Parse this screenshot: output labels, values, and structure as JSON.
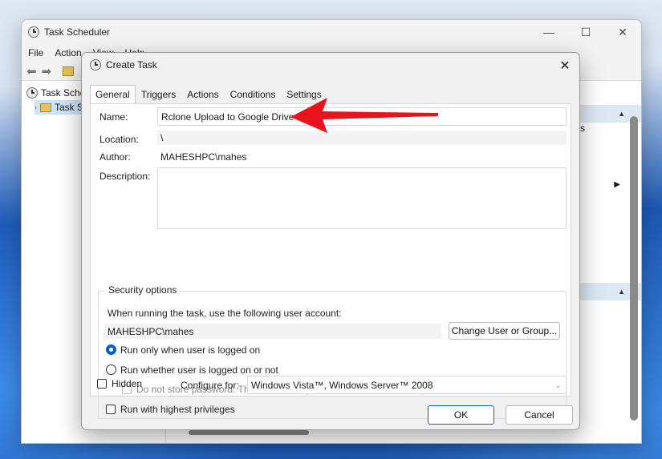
{
  "main_window": {
    "title": "Task Scheduler",
    "controls": {
      "minimize": "—",
      "maximize": "☐",
      "close": "✕"
    },
    "menu": [
      "File",
      "Action",
      "View",
      "Help"
    ],
    "tree": {
      "root": "Task Sched",
      "child": "Task S"
    },
    "right_pane_fragment": "s"
  },
  "dialog": {
    "title": "Create Task",
    "close": "✕",
    "tabs": [
      "General",
      "Triggers",
      "Actions",
      "Conditions",
      "Settings"
    ],
    "active_tab": "General",
    "name_label": "Name:",
    "name_value": "Rclone Upload to Google Drive",
    "location_label": "Location:",
    "location_value": "\\",
    "author_label": "Author:",
    "author_value": "MAHESHPC\\mahes",
    "description_label": "Description:",
    "description_value": "",
    "security": {
      "title": "Security options",
      "account_prompt": "When running the task, use the following user account:",
      "account": "MAHESHPC\\mahes",
      "change_button": "Change User or Group...",
      "run_logged_on": "Run only when user is logged on",
      "run_whether": "Run whether user is logged on or not",
      "no_store_password": "Do not store password.  The task will only have access to local computer resources.",
      "highest_privileges": "Run with highest privileges",
      "selected_option": "run_logged_on"
    },
    "hidden_label": "Hidden",
    "configure_label": "Configure for:",
    "configure_value": "Windows Vista™, Windows Server™ 2008",
    "ok_button": "OK",
    "cancel_button": "Cancel"
  },
  "colors": {
    "annotation_arrow": "#e8141b",
    "accent": "#0a5fc4"
  },
  "icons": [
    "clock-icon",
    "folder-icon",
    "back-arrow-icon",
    "forward-arrow-icon",
    "close-icon",
    "chevron-down-icon",
    "red-arrow-annotation"
  ]
}
